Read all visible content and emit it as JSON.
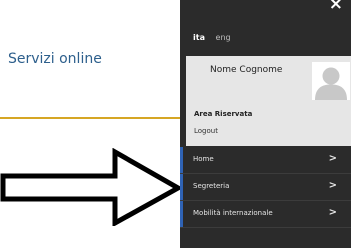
{
  "page": {
    "title": "Servizi online"
  },
  "sidebar": {
    "close_glyph": "×",
    "languages": {
      "active": "ita",
      "inactive": "eng"
    },
    "user": {
      "name": "Nome Cognome",
      "area_label": "Area Riservata",
      "logout_label": "Logout"
    },
    "menu": [
      {
        "label": "Home",
        "icon": "chevron-right-icon"
      },
      {
        "label": "Segreteria",
        "icon": "chevron-right-icon"
      },
      {
        "label": "Mobilità internazionale",
        "icon": "chevron-right-icon"
      }
    ]
  },
  "colors": {
    "title": "#2d5f8c",
    "rule": "#d6a624",
    "sidebar_bg": "#2b2b2b",
    "user_box_bg": "#e6e6e6",
    "menu_accent": "#2f63b5"
  }
}
